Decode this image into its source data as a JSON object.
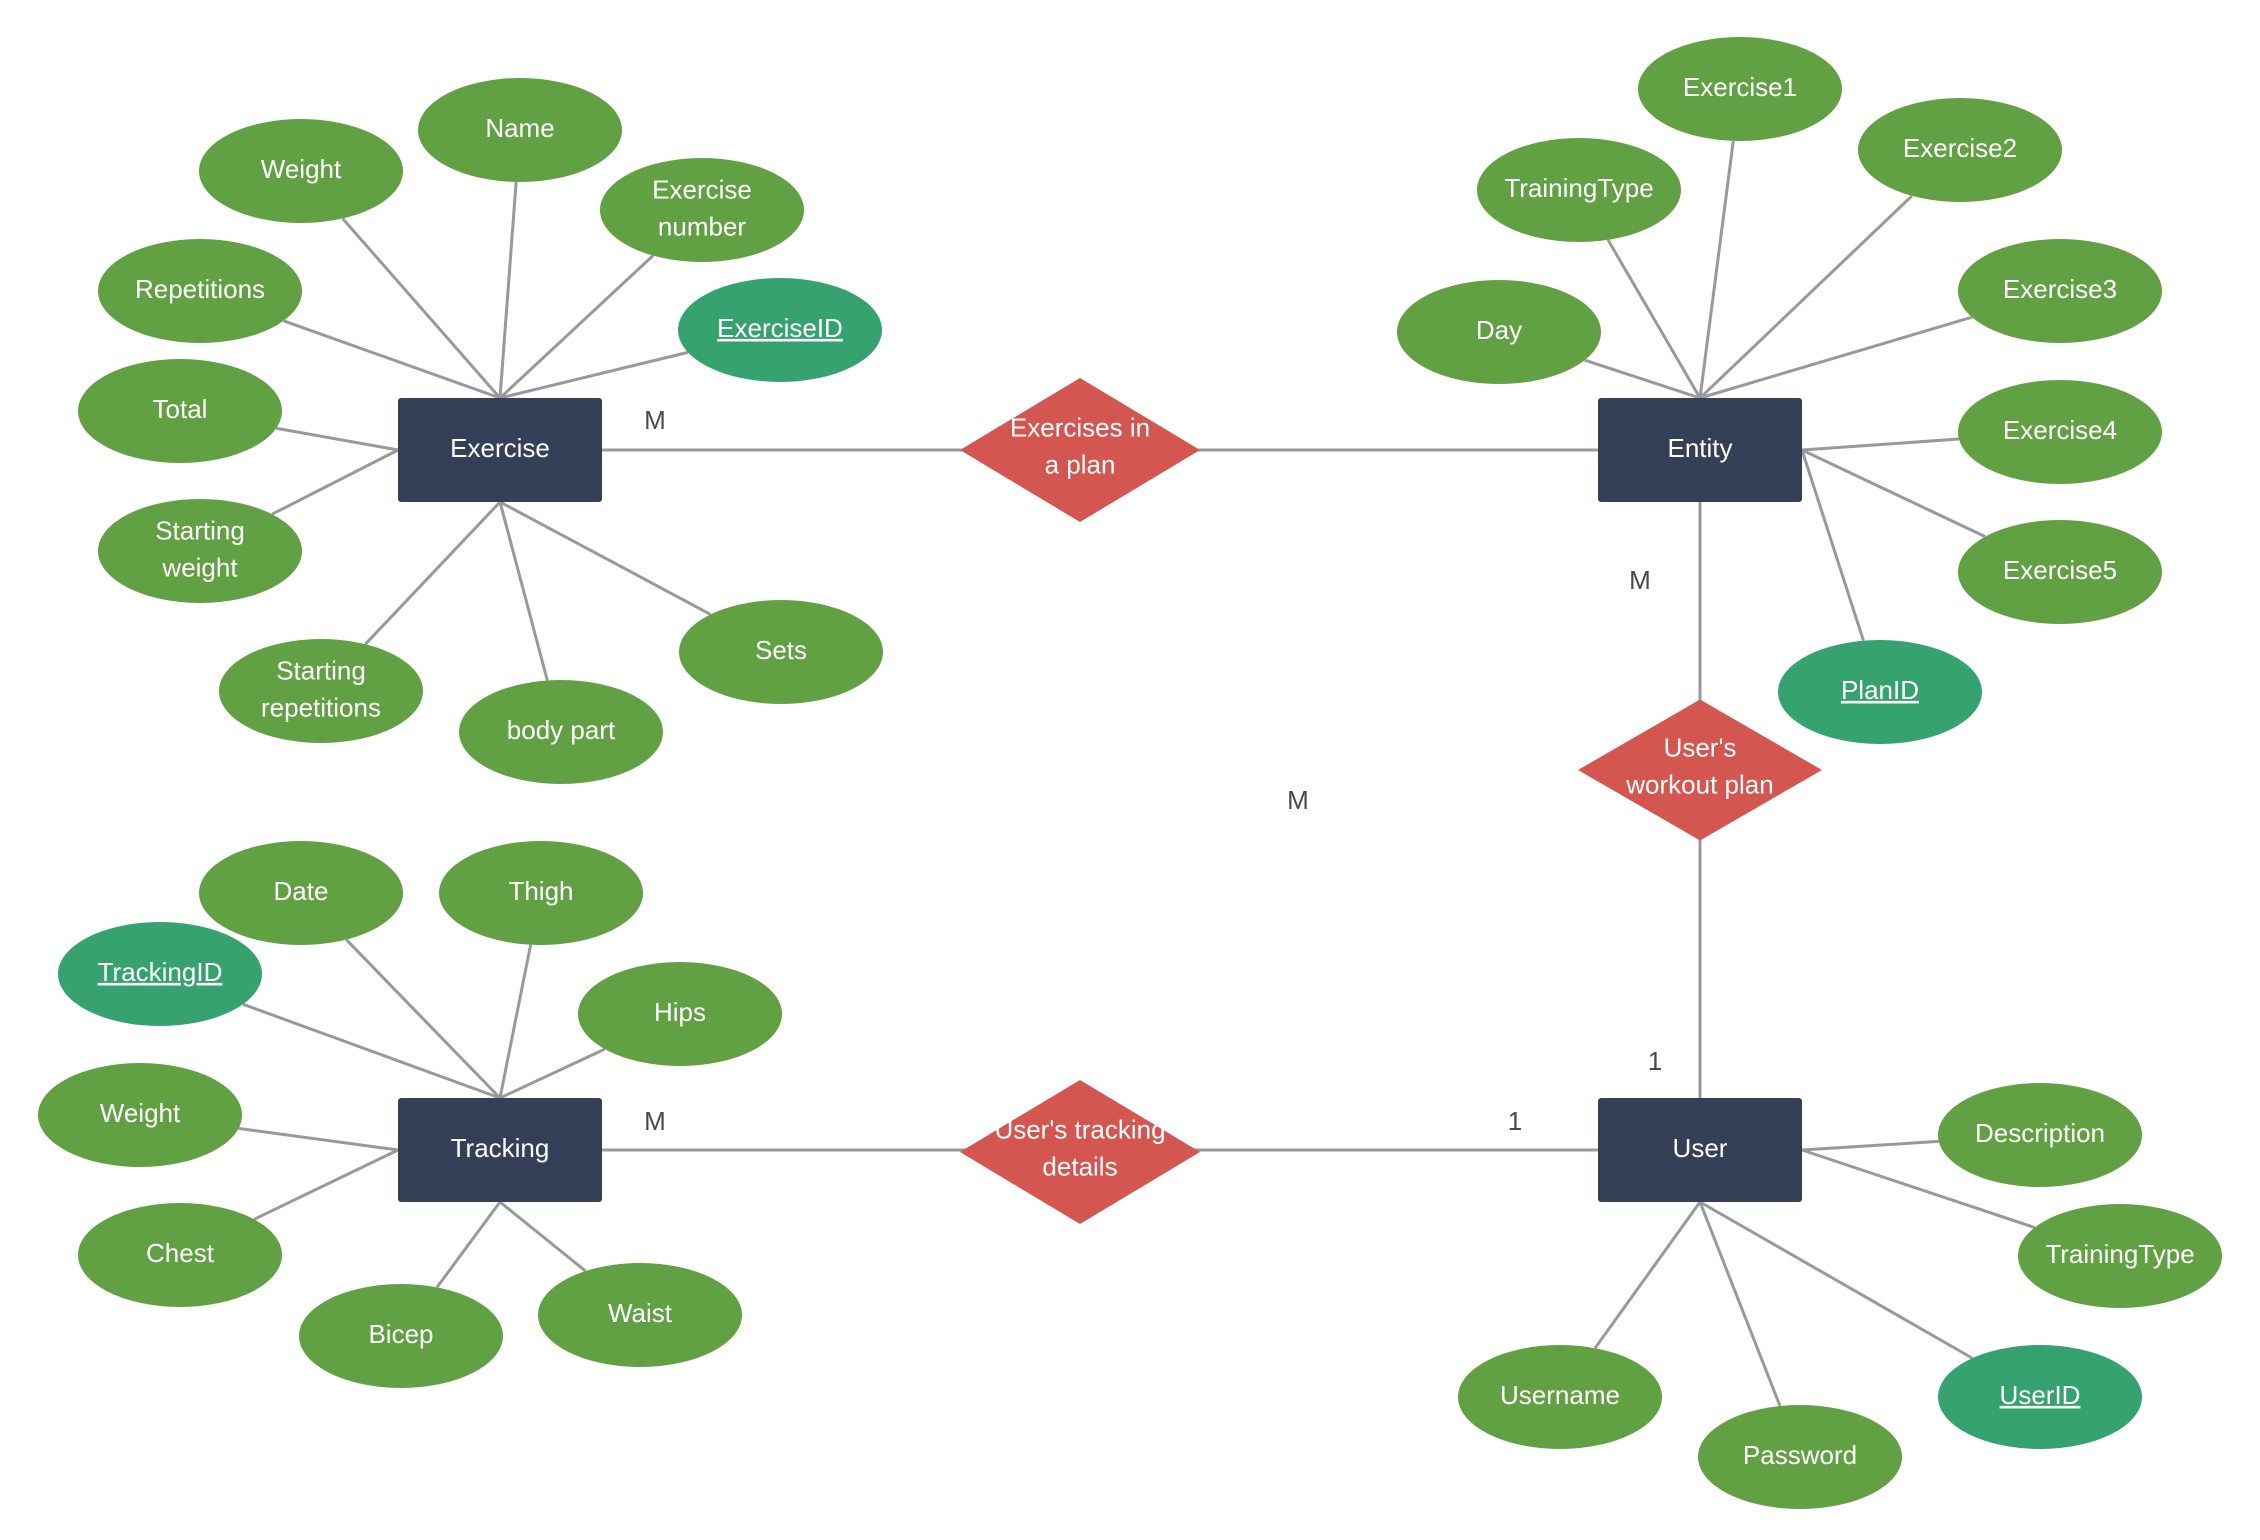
{
  "diagram": {
    "type": "entity-relationship",
    "colors": {
      "entity": "#344058",
      "attribute": "#62a044",
      "key_attribute": "#35a26f",
      "relationship": "#d35650",
      "connector": "#999999",
      "cardinality_text": "#444a52"
    },
    "entities": [
      {
        "id": "exercise",
        "label": "Exercise",
        "attributes": [
          {
            "label": "Name",
            "lines": [
              "Name"
            ],
            "key": false
          },
          {
            "label": "Weight",
            "lines": [
              "Weight"
            ],
            "key": false
          },
          {
            "label": "Exercise number",
            "lines": [
              "Exercise",
              "number"
            ],
            "key": false
          },
          {
            "label": "Repetitions",
            "lines": [
              "Repetitions"
            ],
            "key": false
          },
          {
            "label": "ExerciseID",
            "lines": [
              "ExerciseID"
            ],
            "key": true
          },
          {
            "label": "Total",
            "lines": [
              "Total"
            ],
            "key": false
          },
          {
            "label": "Starting weight",
            "lines": [
              "Starting",
              "weight"
            ],
            "key": false
          },
          {
            "label": "Sets",
            "lines": [
              "Sets"
            ],
            "key": false
          },
          {
            "label": "Starting repetitions",
            "lines": [
              "Starting",
              "repetitions"
            ],
            "key": false
          },
          {
            "label": "body part",
            "lines": [
              "body part"
            ],
            "key": false
          }
        ]
      },
      {
        "id": "entity",
        "label": "Entity",
        "attributes": [
          {
            "label": "Exercise1",
            "lines": [
              "Exercise1"
            ],
            "key": false
          },
          {
            "label": "TrainingType",
            "lines": [
              "TrainingType"
            ],
            "key": false
          },
          {
            "label": "Exercise2",
            "lines": [
              "Exercise2"
            ],
            "key": false
          },
          {
            "label": "Day",
            "lines": [
              "Day"
            ],
            "key": false
          },
          {
            "label": "Exercise3",
            "lines": [
              "Exercise3"
            ],
            "key": false
          },
          {
            "label": "Exercise4",
            "lines": [
              "Exercise4"
            ],
            "key": false
          },
          {
            "label": "Exercise5",
            "lines": [
              "Exercise5"
            ],
            "key": false
          },
          {
            "label": "PlanID",
            "lines": [
              "PlanID"
            ],
            "key": true
          }
        ]
      },
      {
        "id": "tracking",
        "label": "Tracking",
        "attributes": [
          {
            "label": "Date",
            "lines": [
              "Date"
            ],
            "key": false
          },
          {
            "label": "Thigh",
            "lines": [
              "Thigh"
            ],
            "key": false
          },
          {
            "label": "TrackingID",
            "lines": [
              "TrackingID"
            ],
            "key": true
          },
          {
            "label": "Hips",
            "lines": [
              "Hips"
            ],
            "key": false
          },
          {
            "label": "Weight",
            "lines": [
              "Weight"
            ],
            "key": false
          },
          {
            "label": "Chest",
            "lines": [
              "Chest"
            ],
            "key": false
          },
          {
            "label": "Bicep",
            "lines": [
              "Bicep"
            ],
            "key": false
          },
          {
            "label": "Waist",
            "lines": [
              "Waist"
            ],
            "key": false
          }
        ]
      },
      {
        "id": "user",
        "label": "User",
        "attributes": [
          {
            "label": "Description",
            "lines": [
              "Description"
            ],
            "key": false
          },
          {
            "label": "TrainingType",
            "lines": [
              "TrainingType"
            ],
            "key": false
          },
          {
            "label": "Username",
            "lines": [
              "Username"
            ],
            "key": false
          },
          {
            "label": "Password",
            "lines": [
              "Password"
            ],
            "key": false
          },
          {
            "label": "UserID",
            "lines": [
              "UserID"
            ],
            "key": true
          }
        ]
      }
    ],
    "relationships": [
      {
        "id": "exercises-in-plan",
        "label": "Exercises in a plan",
        "lines": [
          "Exercises in",
          "a plan"
        ],
        "from": "exercise",
        "to": "entity"
      },
      {
        "id": "users-workout-plan",
        "label": "User's workout plan",
        "lines": [
          "User's",
          "workout plan"
        ],
        "from": "entity",
        "to": "user"
      },
      {
        "id": "users-tracking-details",
        "label": "User's tracking details",
        "lines": [
          "User's tracking",
          "details"
        ],
        "from": "tracking",
        "to": "user"
      }
    ],
    "cardinalities": [
      {
        "id": "exercise-side",
        "text": "M"
      },
      {
        "id": "entity-side",
        "text": "M"
      },
      {
        "id": "floating",
        "text": "M"
      },
      {
        "id": "tracking-side",
        "text": "M"
      },
      {
        "id": "user-top",
        "text": "1"
      },
      {
        "id": "user-left",
        "text": "1"
      }
    ]
  }
}
